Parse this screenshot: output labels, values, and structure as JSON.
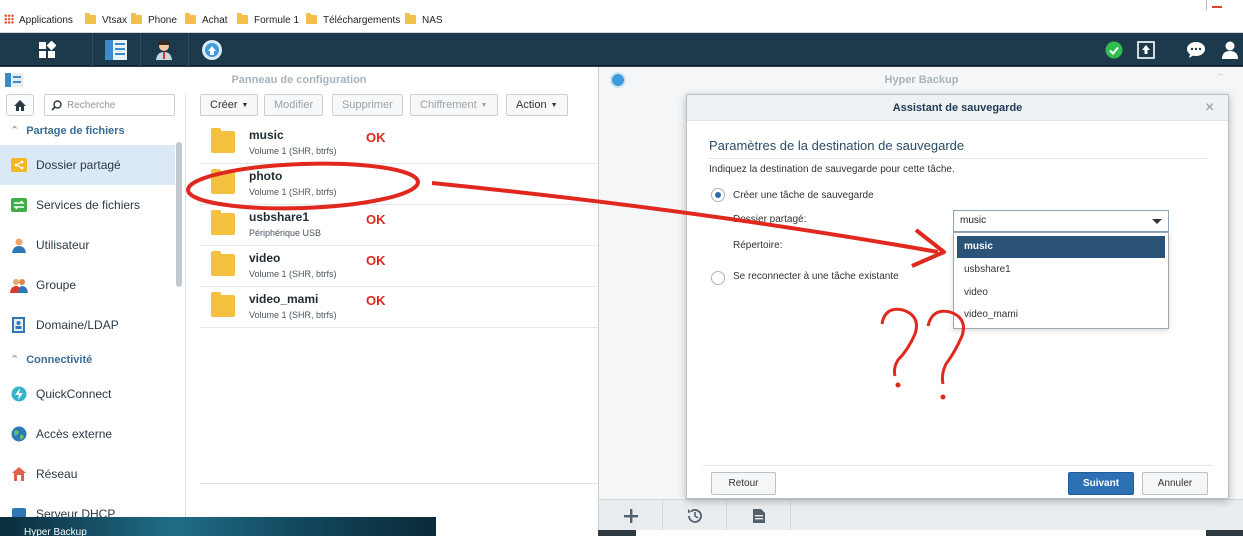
{
  "bookmarks": {
    "apps_label": "Applications",
    "items": [
      "Vtsax",
      "Phone",
      "Achat",
      "Formule 1",
      "Téléchargements",
      "NAS"
    ]
  },
  "taskbar": {
    "left_icons": [
      "main-menu-icon",
      "package-center-icon",
      "user-icon",
      "hyper-backup-icon"
    ],
    "right_icons": [
      "status-ok-icon",
      "upload-icon",
      "chat-icon",
      "account-icon"
    ]
  },
  "control_panel": {
    "title": "Panneau de configuration",
    "search_placeholder": "Recherche",
    "sections": [
      {
        "label": "Partage de fichiers",
        "items": [
          {
            "label": "Dossier partagé",
            "icon": "shared-folder-icon",
            "active": true
          },
          {
            "label": "Services de fichiers",
            "icon": "file-services-icon"
          },
          {
            "label": "Utilisateur",
            "icon": "user-icon"
          },
          {
            "label": "Groupe",
            "icon": "group-icon"
          },
          {
            "label": "Domaine/LDAP",
            "icon": "domain-icon"
          }
        ]
      },
      {
        "label": "Connectivité",
        "items": [
          {
            "label": "QuickConnect",
            "icon": "quickconnect-icon"
          },
          {
            "label": "Accès externe",
            "icon": "globe-icon"
          },
          {
            "label": "Réseau",
            "icon": "network-icon"
          },
          {
            "label": "Serveur DHCP",
            "icon": "dhcp-icon"
          }
        ]
      }
    ],
    "toolbar": {
      "create": "Créer",
      "modify": "Modifier",
      "delete": "Supprimer",
      "encryption": "Chiffrement",
      "action": "Action"
    },
    "shares": [
      {
        "name": "music",
        "sub": "Volume 1 (SHR, btrfs)",
        "annotation": "OK"
      },
      {
        "name": "photo",
        "sub": "Volume 1 (SHR, btrfs)",
        "annotation": ""
      },
      {
        "name": "usbshare1",
        "sub": "Périphérique USB",
        "annotation": "OK"
      },
      {
        "name": "video",
        "sub": "Volume 1 (SHR, btrfs)",
        "annotation": "OK"
      },
      {
        "name": "video_mami",
        "sub": "Volume 1 (SHR, btrfs)",
        "annotation": "OK"
      }
    ]
  },
  "hyper_backup": {
    "title": "Hyper Backup",
    "bottom_icons": [
      "add-icon",
      "restore-icon",
      "log-icon"
    ]
  },
  "wizard": {
    "title": "Assistant de sauvegarde",
    "section_title": "Paramètres de la destination de sauvegarde",
    "description": "Indiquez la destination de sauvegarde pour cette tâche.",
    "option_create": "Créer une tâche de sauvegarde",
    "shared_folder_label": "Dossier partagé:",
    "shared_folder_value": "music",
    "directory_label": "Répertoire:",
    "option_reconnect": "Se reconnecter à une tâche existante",
    "dropdown_options": [
      "music",
      "usbshare1",
      "video",
      "video_mami"
    ],
    "buttons": {
      "back": "Retour",
      "next": "Suivant",
      "cancel": "Annuler"
    }
  },
  "desktop": {
    "taskbar_title": "Hyper Backup"
  },
  "colors": {
    "taskbar_bg": "#1d3a4d",
    "accent": "#2d70b3",
    "folder": "#f4c040",
    "annotation_red": "#e1281f",
    "selected_bg": "#2b5378"
  }
}
